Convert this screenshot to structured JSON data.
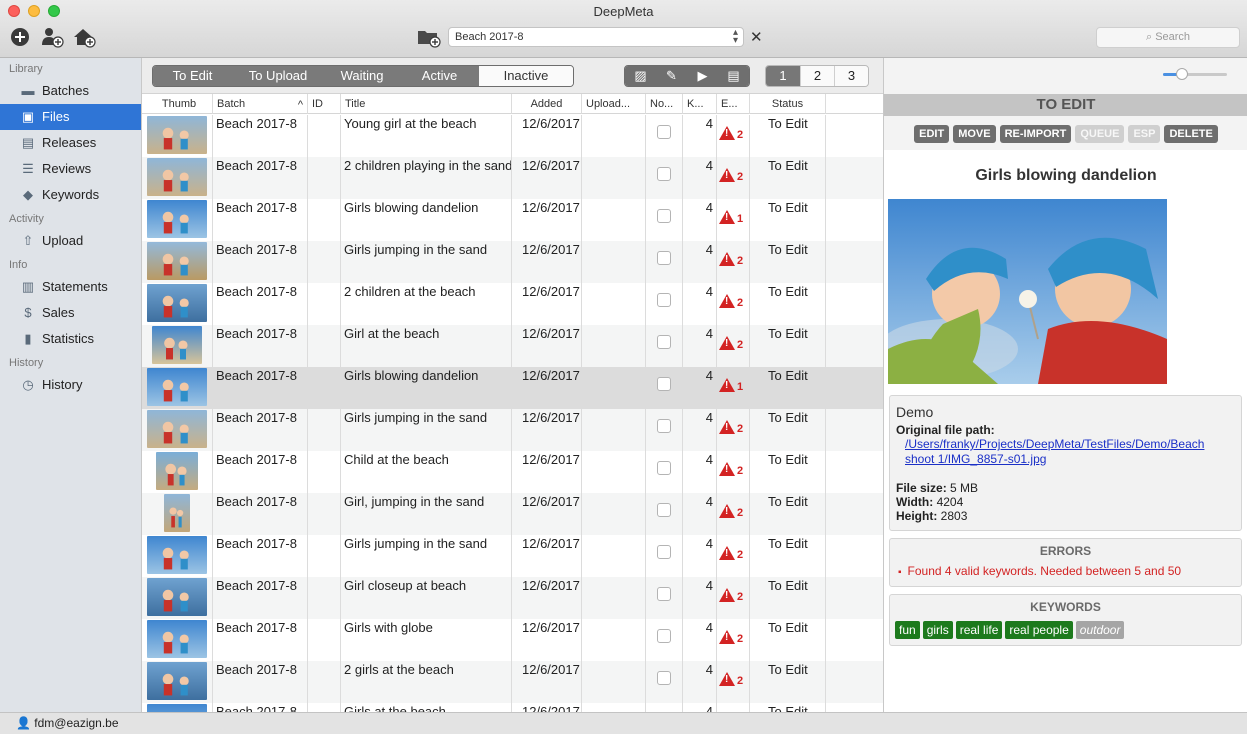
{
  "window": {
    "title": "DeepMeta"
  },
  "toolbar": {
    "batch_selected": "Beach 2017-8",
    "clear_symbol": "✕",
    "search_placeholder": "Search",
    "icons": [
      "add-circle-icon",
      "add-user-icon",
      "add-home-icon",
      "folder-add-icon"
    ]
  },
  "sidebar": {
    "sections": [
      {
        "title": "Library",
        "items": [
          {
            "label": "Batches",
            "icon": "folder-icon"
          },
          {
            "label": "Files",
            "icon": "image-icon",
            "active": true
          },
          {
            "label": "Releases",
            "icon": "document-icon"
          },
          {
            "label": "Reviews",
            "icon": "checklist-icon"
          },
          {
            "label": "Keywords",
            "icon": "tag-icon"
          }
        ]
      },
      {
        "title": "Activity",
        "items": [
          {
            "label": "Upload",
            "icon": "upload-icon"
          }
        ]
      },
      {
        "title": "Info",
        "items": [
          {
            "label": "Statements",
            "icon": "statement-icon"
          },
          {
            "label": "Sales",
            "icon": "dollar-icon"
          },
          {
            "label": "Statistics",
            "icon": "bar-chart-icon"
          }
        ]
      },
      {
        "title": "History",
        "items": [
          {
            "label": "History",
            "icon": "clock-icon"
          }
        ]
      }
    ]
  },
  "filters": {
    "status_tabs": [
      "To Edit",
      "To Upload",
      "Waiting",
      "Active",
      "Inactive"
    ],
    "selected_status": "Inactive",
    "view_icons": [
      "image-view-icon",
      "edit-brush-icon",
      "play-icon",
      "detail-view-icon"
    ],
    "pages": [
      "1",
      "2",
      "3"
    ],
    "selected_page": "1"
  },
  "table": {
    "columns": [
      "Thumb",
      "Batch",
      "ID",
      "Title",
      "Added",
      "Upload...",
      "No...",
      "K...",
      "E...",
      "Status"
    ],
    "sort_indicator": "^",
    "rows": [
      {
        "batch": "Beach 2017-8",
        "id": "",
        "title": "Young girl at the beach",
        "added": "12/6/2017",
        "kw": "4",
        "errors": "2",
        "status": "To Edit",
        "thumb": "beach-wide"
      },
      {
        "batch": "Beach 2017-8",
        "id": "",
        "title": "2 children playing in the sand",
        "added": "12/6/2017",
        "kw": "4",
        "errors": "2",
        "status": "To Edit",
        "thumb": "beach-wide"
      },
      {
        "batch": "Beach 2017-8",
        "id": "",
        "title": "Girls blowing dandelion",
        "added": "12/6/2017",
        "kw": "4",
        "errors": "1",
        "status": "To Edit",
        "thumb": "sky-wide"
      },
      {
        "batch": "Beach 2017-8",
        "id": "",
        "title": "Girls jumping in the sand",
        "added": "12/6/2017",
        "kw": "4",
        "errors": "2",
        "status": "To Edit",
        "thumb": "dune-wide"
      },
      {
        "batch": "Beach 2017-8",
        "id": "",
        "title": "2 children at the beach",
        "added": "12/6/2017",
        "kw": "4",
        "errors": "2",
        "status": "To Edit",
        "thumb": "sea-wide"
      },
      {
        "batch": "Beach 2017-8",
        "id": "",
        "title": "Girl at the beach",
        "added": "12/6/2017",
        "kw": "4",
        "errors": "2",
        "status": "To Edit",
        "thumb": "sky-narrow"
      },
      {
        "batch": "Beach 2017-8",
        "id": "",
        "title": "Girls blowing dandelion",
        "added": "12/6/2017",
        "kw": "4",
        "errors": "1",
        "status": "To Edit",
        "thumb": "sky-wide",
        "selected": true
      },
      {
        "batch": "Beach 2017-8",
        "id": "",
        "title": "Girls jumping in the sand",
        "added": "12/6/2017",
        "kw": "4",
        "errors": "2",
        "status": "To Edit",
        "thumb": "beach-wide"
      },
      {
        "batch": "Beach 2017-8",
        "id": "",
        "title": "Child at the beach",
        "added": "12/6/2017",
        "kw": "4",
        "errors": "2",
        "status": "To Edit",
        "thumb": "sea-narrow"
      },
      {
        "batch": "Beach 2017-8",
        "id": "",
        "title": "Girl, jumping in the sand",
        "added": "12/6/2017",
        "kw": "4",
        "errors": "2",
        "status": "To Edit",
        "thumb": "sand-tall"
      },
      {
        "batch": "Beach 2017-8",
        "id": "",
        "title": "Girls jumping in the sand",
        "added": "12/6/2017",
        "kw": "4",
        "errors": "2",
        "status": "To Edit",
        "thumb": "sky-wide"
      },
      {
        "batch": "Beach 2017-8",
        "id": "",
        "title": "Girl closeup at beach",
        "added": "12/6/2017",
        "kw": "4",
        "errors": "2",
        "status": "To Edit",
        "thumb": "sea-wide"
      },
      {
        "batch": "Beach 2017-8",
        "id": "",
        "title": "Girls with globe",
        "added": "12/6/2017",
        "kw": "4",
        "errors": "2",
        "status": "To Edit",
        "thumb": "sky-wide"
      },
      {
        "batch": "Beach 2017-8",
        "id": "",
        "title": "2 girls at the beach",
        "added": "12/6/2017",
        "kw": "4",
        "errors": "2",
        "status": "To Edit",
        "thumb": "sea-wide"
      },
      {
        "batch": "Beach 2017-8",
        "id": "",
        "title": "Girls at the beach",
        "added": "12/6/2017",
        "kw": "4",
        "errors": "",
        "status": "To Edit",
        "thumb": "sky-wide"
      }
    ]
  },
  "detail": {
    "state": "TO EDIT",
    "actions": [
      {
        "label": "EDIT",
        "enabled": true
      },
      {
        "label": "MOVE",
        "enabled": true
      },
      {
        "label": "RE-IMPORT",
        "enabled": true
      },
      {
        "label": "QUEUE",
        "enabled": false
      },
      {
        "label": "ESP",
        "enabled": false
      },
      {
        "label": "DELETE",
        "enabled": true
      }
    ],
    "title": "Girls blowing dandelion",
    "thumbnail_size": 0.3,
    "info": {
      "batch": "Demo",
      "path_label": "Original file path:",
      "path_line1": "/Users/franky/Projects/DeepMeta/TestFiles/Demo/Beach",
      "path_line2": "shoot 1/IMG_8857-s01.jpg",
      "size_label": "File size:",
      "size": "5 MB",
      "width_label": "Width:",
      "width": "4204",
      "height_label": "Height:",
      "height": "2803"
    },
    "errors_title": "ERRORS",
    "errors": [
      "Found 4 valid keywords. Needed between 5 and 50"
    ],
    "keywords_title": "KEYWORDS",
    "keywords": [
      {
        "label": "fun",
        "valid": true
      },
      {
        "label": "girls",
        "valid": true
      },
      {
        "label": "real life",
        "valid": true
      },
      {
        "label": "real people",
        "valid": true
      },
      {
        "label": "outdoor",
        "valid": false
      }
    ]
  },
  "user": {
    "email": "fdm@eazign.be"
  },
  "colors": {
    "accent": "#2f75d6",
    "error": "#d32323",
    "keyword_valid": "#1d7a1d",
    "keyword_invalid": "#a5a5a5"
  }
}
